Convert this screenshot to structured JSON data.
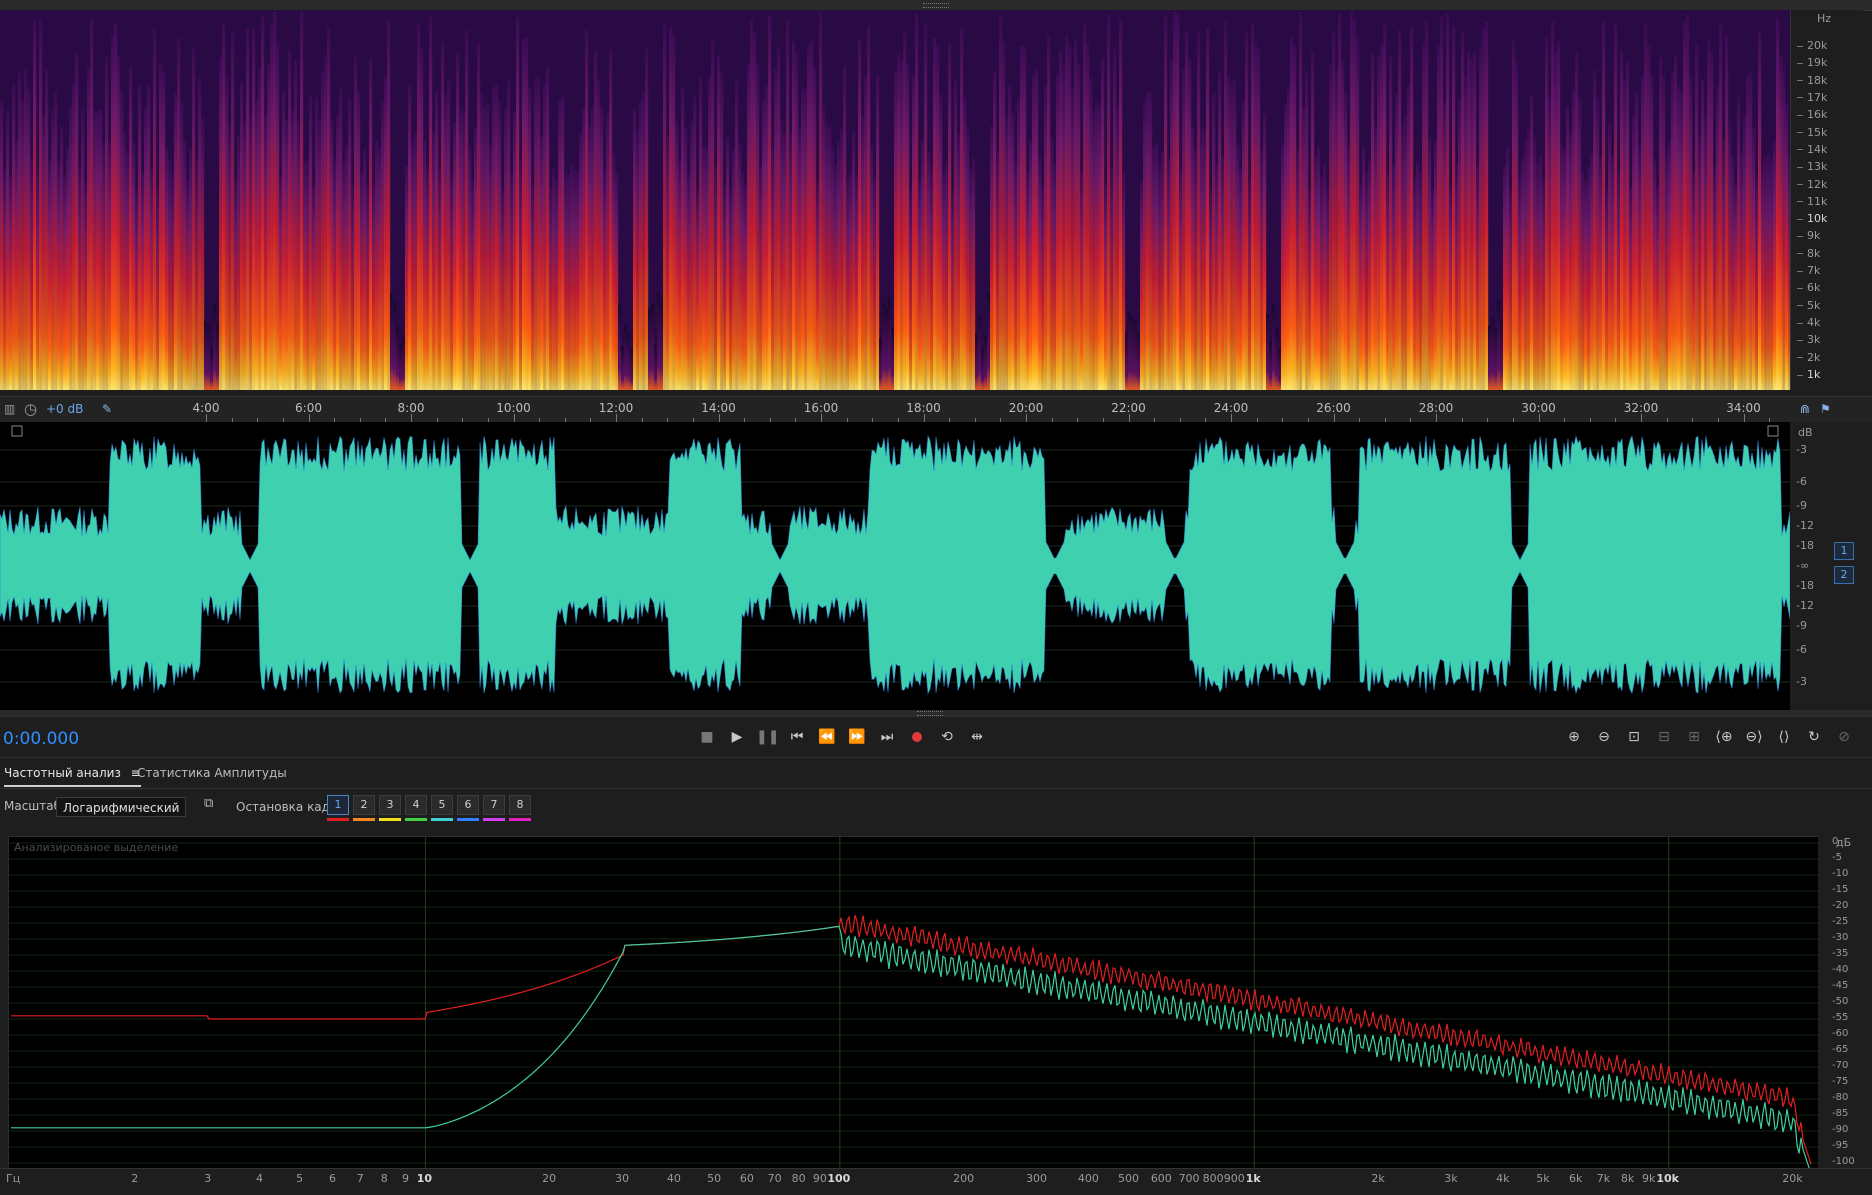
{
  "spectrogram": {
    "hz_unit": "Hz",
    "hz_ticks": [
      "20k",
      "19k",
      "18k",
      "17k",
      "16k",
      "15k",
      "14k",
      "13k",
      "12k",
      "11k",
      "10k",
      "9k",
      "8k",
      "7k",
      "6k",
      "5k",
      "4k",
      "3k",
      "2k",
      "1k"
    ]
  },
  "timeline": {
    "gain_label": "+0 dB",
    "time_labels": [
      "4:00",
      "6:00",
      "8:00",
      "10:00",
      "12:00",
      "14:00",
      "16:00",
      "18:00",
      "20:00",
      "22:00",
      "24:00",
      "26:00",
      "28:00",
      "30:00",
      "32:00",
      "34:00"
    ]
  },
  "waveform": {
    "db_unit": "dB",
    "db_ticks": [
      "-3",
      "-6",
      "-9",
      "-12",
      "-18",
      "-∞",
      "-18",
      "-12",
      "-9",
      "-6",
      "-3"
    ],
    "channels": [
      "1",
      "2"
    ],
    "color": "#3fd0b0"
  },
  "transport": {
    "timecode": "0:00.000",
    "record_color": "#e03a3a"
  },
  "panel": {
    "tabs": [
      {
        "label": "Частотный анализ",
        "menu_icon": "≡"
      },
      {
        "label": "Статистика Амплитуды"
      }
    ]
  },
  "options": {
    "scale_label": "Масштаб:",
    "scale_value": "Логарифмический",
    "freeze_label": "Остановка кадра:",
    "frames": [
      "1",
      "2",
      "3",
      "4",
      "5",
      "6",
      "7",
      "8"
    ],
    "frame_colors": [
      "#e02020",
      "#f08a20",
      "#f0e020",
      "#40d040",
      "#40d0d0",
      "#3080ff",
      "#d040f0",
      "#e020c0"
    ]
  },
  "frequency_plot": {
    "title": "Анализированое выделение",
    "db_unit": "дБ",
    "db_ticks": [
      "0",
      "-5",
      "-10",
      "-15",
      "-20",
      "-25",
      "-30",
      "-35",
      "-40",
      "-45",
      "-50",
      "-55",
      "-60",
      "-65",
      "-70",
      "-75",
      "-80",
      "-85",
      "-90",
      "-95",
      "-100"
    ],
    "freq_unit": "Гц",
    "freq_labels": [
      "2",
      "3",
      "4",
      "5",
      "6",
      "7",
      "8",
      "9",
      "10",
      "20",
      "30",
      "40",
      "50",
      "60",
      "70",
      "80",
      "90",
      "100",
      "200",
      "300",
      "400",
      "500",
      "600",
      "700",
      "800",
      "900",
      "1k",
      "2k",
      "3k",
      "4k",
      "5k",
      "6k",
      "7k",
      "8k",
      "9k",
      "10k",
      "20k"
    ],
    "major_labels": [
      "10",
      "100",
      "1k",
      "10k"
    ],
    "series_colors": {
      "channel_1": "#e02020",
      "channel_2": "#3fd0a0"
    }
  }
}
